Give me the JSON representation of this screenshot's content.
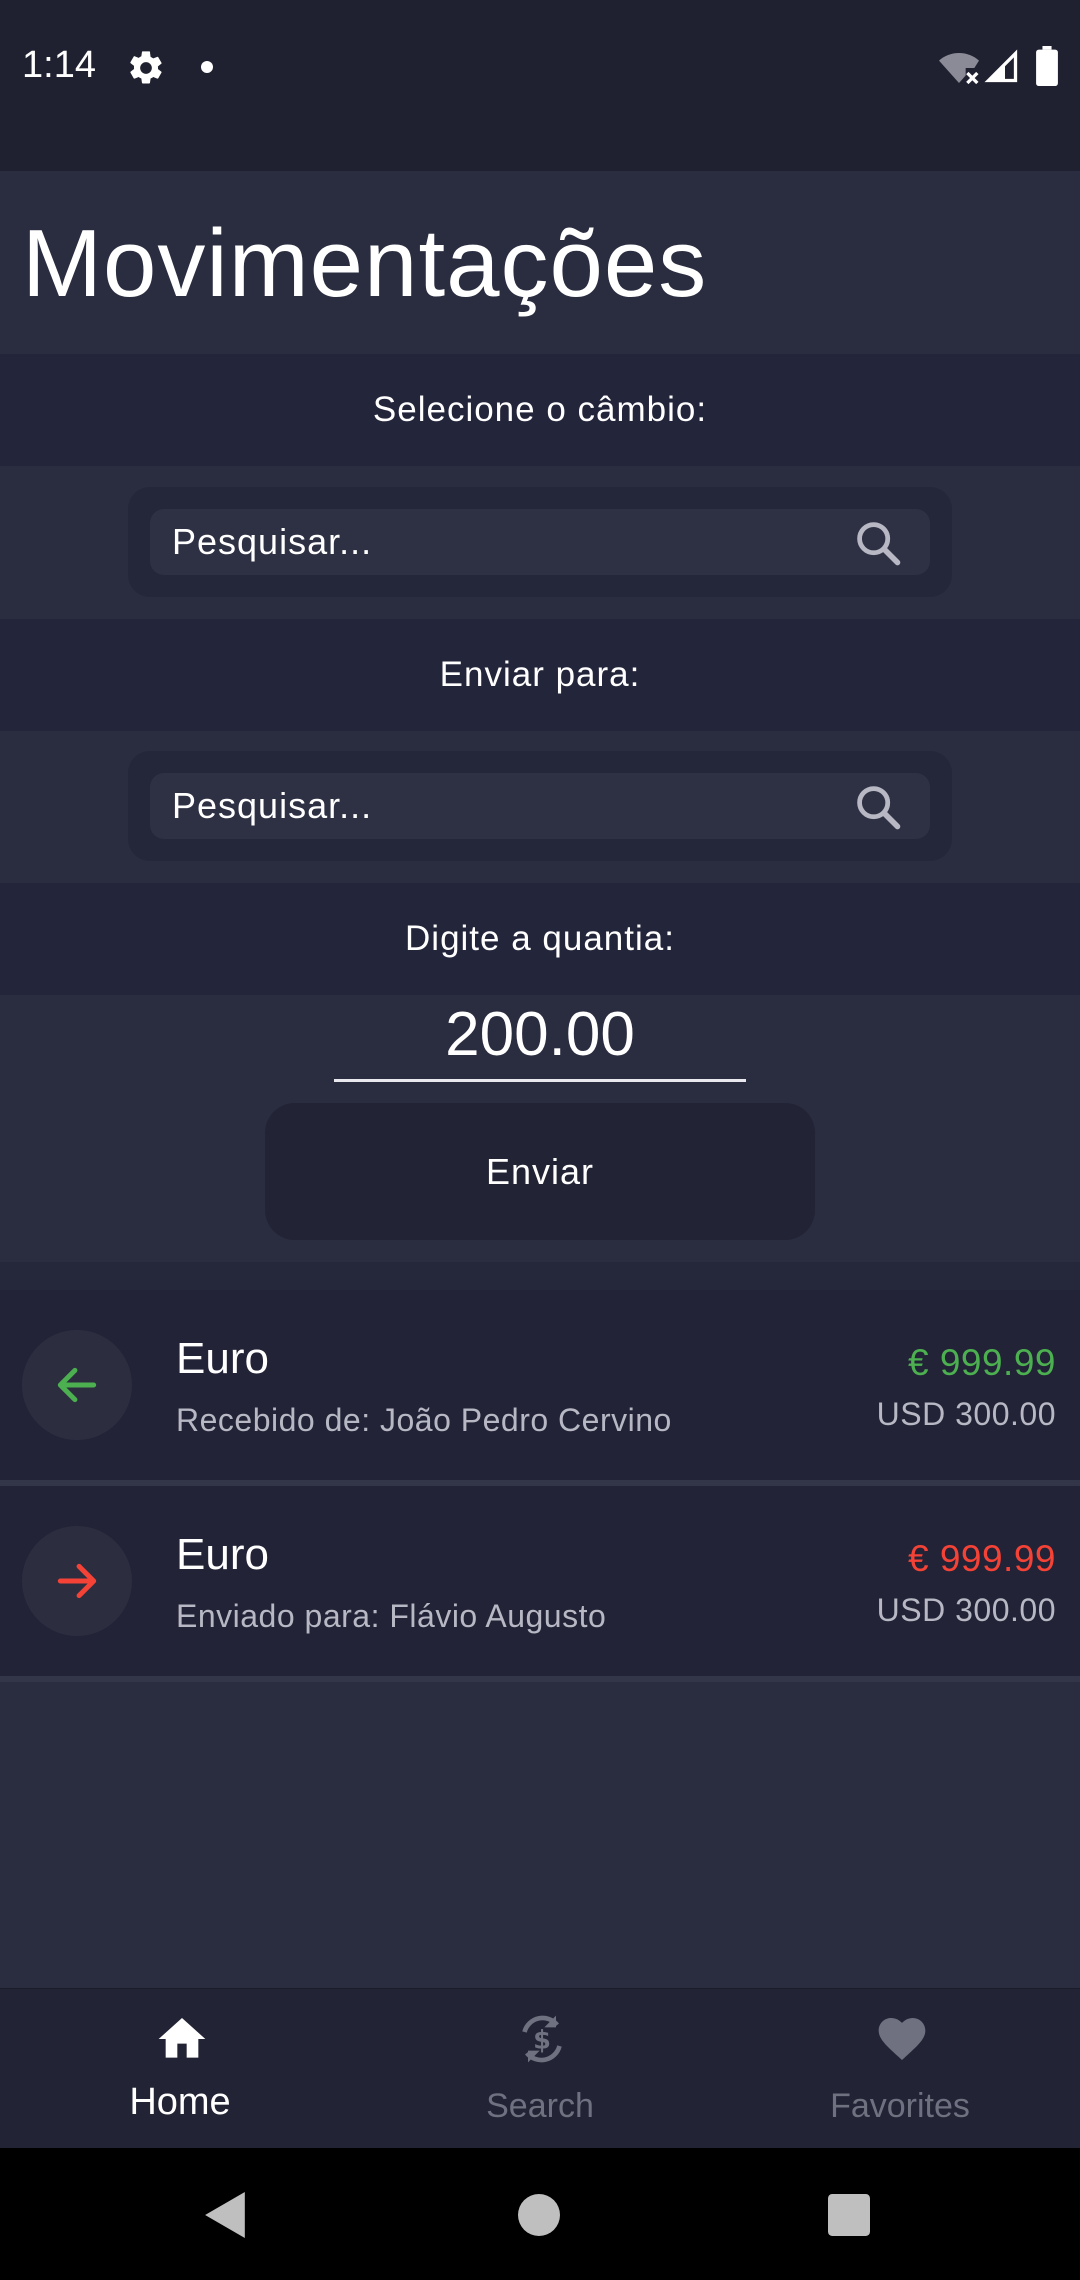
{
  "status_bar": {
    "time": "1:14",
    "icons": [
      "gear-icon",
      "notification-dot-icon",
      "wifi-off-icon",
      "signal-icon",
      "battery-icon"
    ]
  },
  "header": {
    "title": "Movimentações"
  },
  "exchange": {
    "label": "Selecione o câmbio:",
    "search_placeholder": "Pesquisar..."
  },
  "recipient": {
    "label": "Enviar para:",
    "search_placeholder": "Pesquisar..."
  },
  "amount": {
    "label": "Digite a quantia:",
    "value": "200.00"
  },
  "send_button": {
    "label": "Enviar"
  },
  "transactions": [
    {
      "title": "Euro",
      "subtitle": "Recebido de: João Pedro Cervino",
      "amount": "€ 999.99",
      "usd": "USD 300.00",
      "direction": "received",
      "icon": "arrow-left-icon",
      "color": "#4caf50"
    },
    {
      "title": "Euro",
      "subtitle": "Enviado para:  Flávio Augusto",
      "amount": "€ 999.99",
      "usd": "USD 300.00",
      "direction": "sent",
      "icon": "arrow-right-icon",
      "color": "#f44336"
    }
  ],
  "bottom_nav": {
    "items": [
      {
        "label": "Home",
        "icon": "home-icon",
        "active": true
      },
      {
        "label": "Search",
        "icon": "currency-exchange-icon",
        "active": false
      },
      {
        "label": "Favorites",
        "icon": "heart-icon",
        "active": false
      }
    ]
  },
  "colors": {
    "background": "#2a2c40",
    "panel": "#222336",
    "received": "#4caf50",
    "sent": "#f44336",
    "muted": "#b7b8c4"
  },
  "system_nav": {
    "icons": [
      "back-icon",
      "home-circle-icon",
      "recents-icon"
    ]
  }
}
